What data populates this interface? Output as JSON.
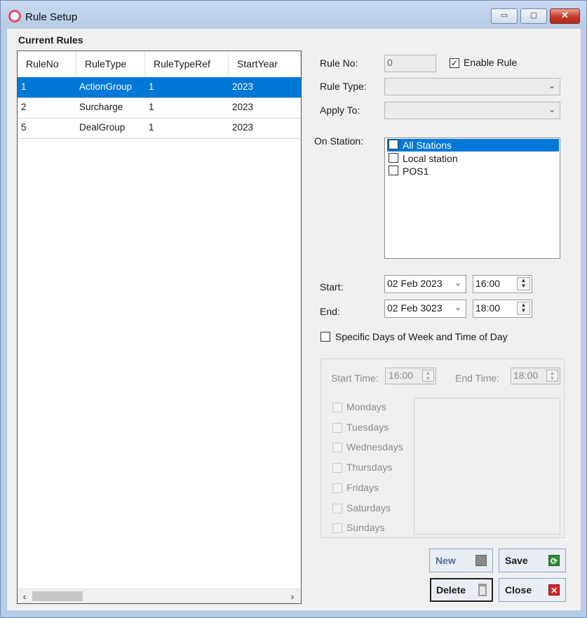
{
  "window": {
    "title": "Rule Setup",
    "min_glyph": "▭",
    "max_glyph": "▢",
    "close_glyph": "✕"
  },
  "rules_group": {
    "label": "Current Rules",
    "columns": [
      "RuleNo",
      "RuleType",
      "RuleTypeRef",
      "StartYear"
    ],
    "rows": [
      [
        "1",
        "ActionGroup",
        "1",
        "2023"
      ],
      [
        "2",
        "Surcharge",
        "1",
        "2023"
      ],
      [
        "5",
        "DealGroup",
        "1",
        "2023"
      ]
    ],
    "selected_row": 0,
    "scroll_left": "‹",
    "scroll_right": "›"
  },
  "form": {
    "rule_no_label": "Rule No:",
    "rule_no_value": "0",
    "enable_rule_label": "Enable Rule",
    "enable_rule_checked": true,
    "rule_type_label": "Rule Type:",
    "rule_type_value": "",
    "apply_to_label": "Apply To:",
    "apply_to_value": "",
    "on_station_label": "On  Station:",
    "stations": [
      "All Stations",
      "Local station",
      "POS1"
    ],
    "start_label": "Start:",
    "start_date": "02 Feb 2023",
    "start_time": "16:00",
    "end_label": "End:",
    "end_date": "02 Feb 3023",
    "end_time": "18:00",
    "specific_days_label": "Specific Days of Week and Time of Day"
  },
  "schedule": {
    "start_time_label": "Start Time:",
    "start_time_value": "16:00",
    "end_time_label": "End Time:",
    "end_time_value": "18:00",
    "days": [
      "Mondays",
      "Tuesdays",
      "Wednesdays",
      "Thursdays",
      "Fridays",
      "Saturdays",
      "Sundays"
    ]
  },
  "buttons": {
    "new": "New",
    "save": "Save",
    "delete": "Delete",
    "close": "Close"
  },
  "colors": {
    "selection": "#0078d7",
    "close_red": "#d6222a",
    "save_green": "#2e8b3a"
  }
}
